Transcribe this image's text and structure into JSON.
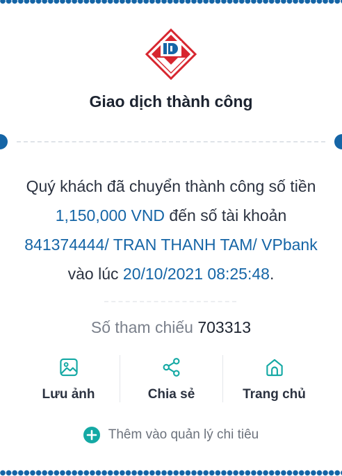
{
  "colors": {
    "brand_blue": "#1565a6",
    "accent_teal": "#14a9a4",
    "brand_red": "#d7262f",
    "text_dark": "#1c2330",
    "text_gray": "#7a808b"
  },
  "header": {
    "logo": "bank-logo",
    "title": "Giao dịch thành công"
  },
  "message": {
    "part1": "Quý khách đã chuyển thành công số tiền ",
    "amount": "1,150,000 VND",
    "part2": " đến số tài khoản ",
    "account_number": "841374444",
    "separator1": "/ ",
    "account_name": "TRAN THANH TAM",
    "separator2": "/ ",
    "bank": "VPbank",
    "part3": " vào lúc ",
    "datetime": "20/10/2021 08:25:48",
    "end": "."
  },
  "reference": {
    "label": "Số tham chiếu",
    "number": "703313"
  },
  "actions": [
    {
      "label": "Lưu ảnh",
      "icon": "image-icon"
    },
    {
      "label": "Chia sẻ",
      "icon": "share-icon"
    },
    {
      "label": "Trang chủ",
      "icon": "home-icon"
    }
  ],
  "add_expense": {
    "label": "Thêm vào quản lý chi tiêu",
    "icon": "plus-circle-icon"
  }
}
